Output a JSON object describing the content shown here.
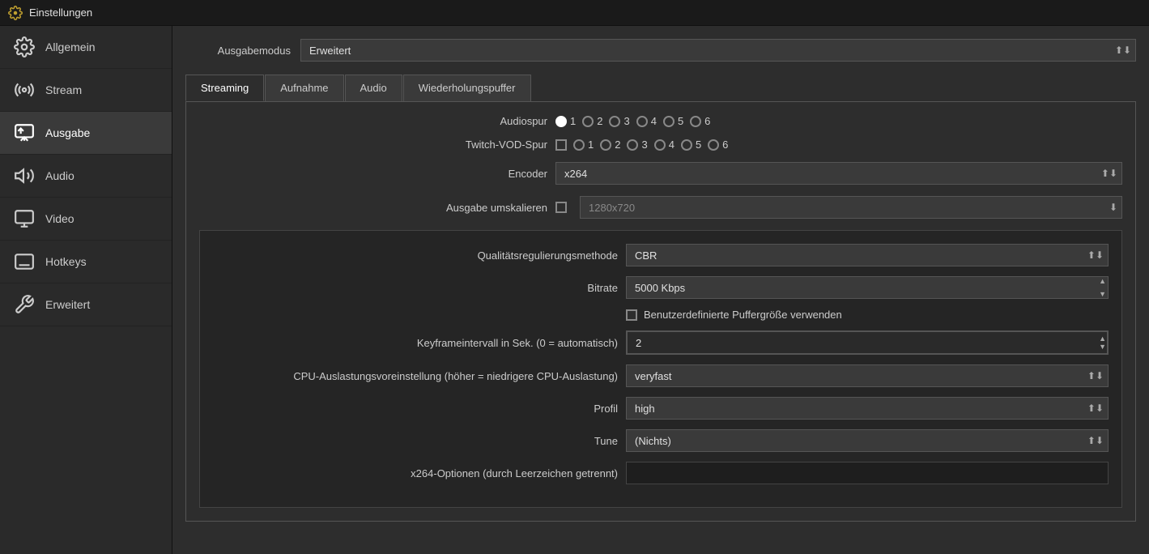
{
  "titlebar": {
    "title": "Einstellungen",
    "icon": "⚙"
  },
  "sidebar": {
    "items": [
      {
        "id": "allgemein",
        "label": "Allgemein",
        "icon": "⚙",
        "active": false
      },
      {
        "id": "stream",
        "label": "Stream",
        "icon": "📡",
        "active": false
      },
      {
        "id": "ausgabe",
        "label": "Ausgabe",
        "icon": "🖥",
        "active": true
      },
      {
        "id": "audio",
        "label": "Audio",
        "icon": "🔊",
        "active": false
      },
      {
        "id": "video",
        "label": "Video",
        "icon": "🖥",
        "active": false
      },
      {
        "id": "hotkeys",
        "label": "Hotkeys",
        "icon": "⌨",
        "active": false
      },
      {
        "id": "erweitert",
        "label": "Erweitert",
        "icon": "🔧",
        "active": false
      }
    ]
  },
  "content": {
    "output_mode_label": "Ausgabemodus",
    "output_mode_value": "Erweitert",
    "tabs": [
      {
        "id": "streaming",
        "label": "Streaming",
        "active": true
      },
      {
        "id": "aufnahme",
        "label": "Aufnahme",
        "active": false
      },
      {
        "id": "audio",
        "label": "Audio",
        "active": false
      },
      {
        "id": "wiederholungspuffer",
        "label": "Wiederholungspuffer",
        "active": false
      }
    ],
    "audiospur_label": "Audiospur",
    "audiospur_tracks": [
      "1",
      "2",
      "3",
      "4",
      "5",
      "6"
    ],
    "twitch_label": "Twitch-VOD-Spur",
    "twitch_tracks": [
      "1",
      "2",
      "3",
      "4",
      "5",
      "6"
    ],
    "encoder_label": "Encoder",
    "encoder_value": "x264",
    "umskalieren_label": "Ausgabe umskalieren",
    "umskalieren_placeholder": "1280x720",
    "inner": {
      "qualitat_label": "Qualitätsregulierungsmethode",
      "qualitat_value": "CBR",
      "bitrate_label": "Bitrate",
      "bitrate_value": "5000 Kbps",
      "puffer_label": "Benutzerdefinierte Puffergröße verwenden",
      "keyframe_label": "Keyframeintervall in Sek. (0 = automatisch)",
      "keyframe_value": "2",
      "cpu_label": "CPU-Auslastungsvoreinstellung (höher = niedrigere CPU-Auslastung)",
      "cpu_value": "veryfast",
      "profil_label": "Profil",
      "profil_value": "high",
      "tune_label": "Tune",
      "tune_value": "(Nichts)",
      "x264_label": "x264-Optionen (durch Leerzeichen getrennt)",
      "x264_value": ""
    }
  }
}
